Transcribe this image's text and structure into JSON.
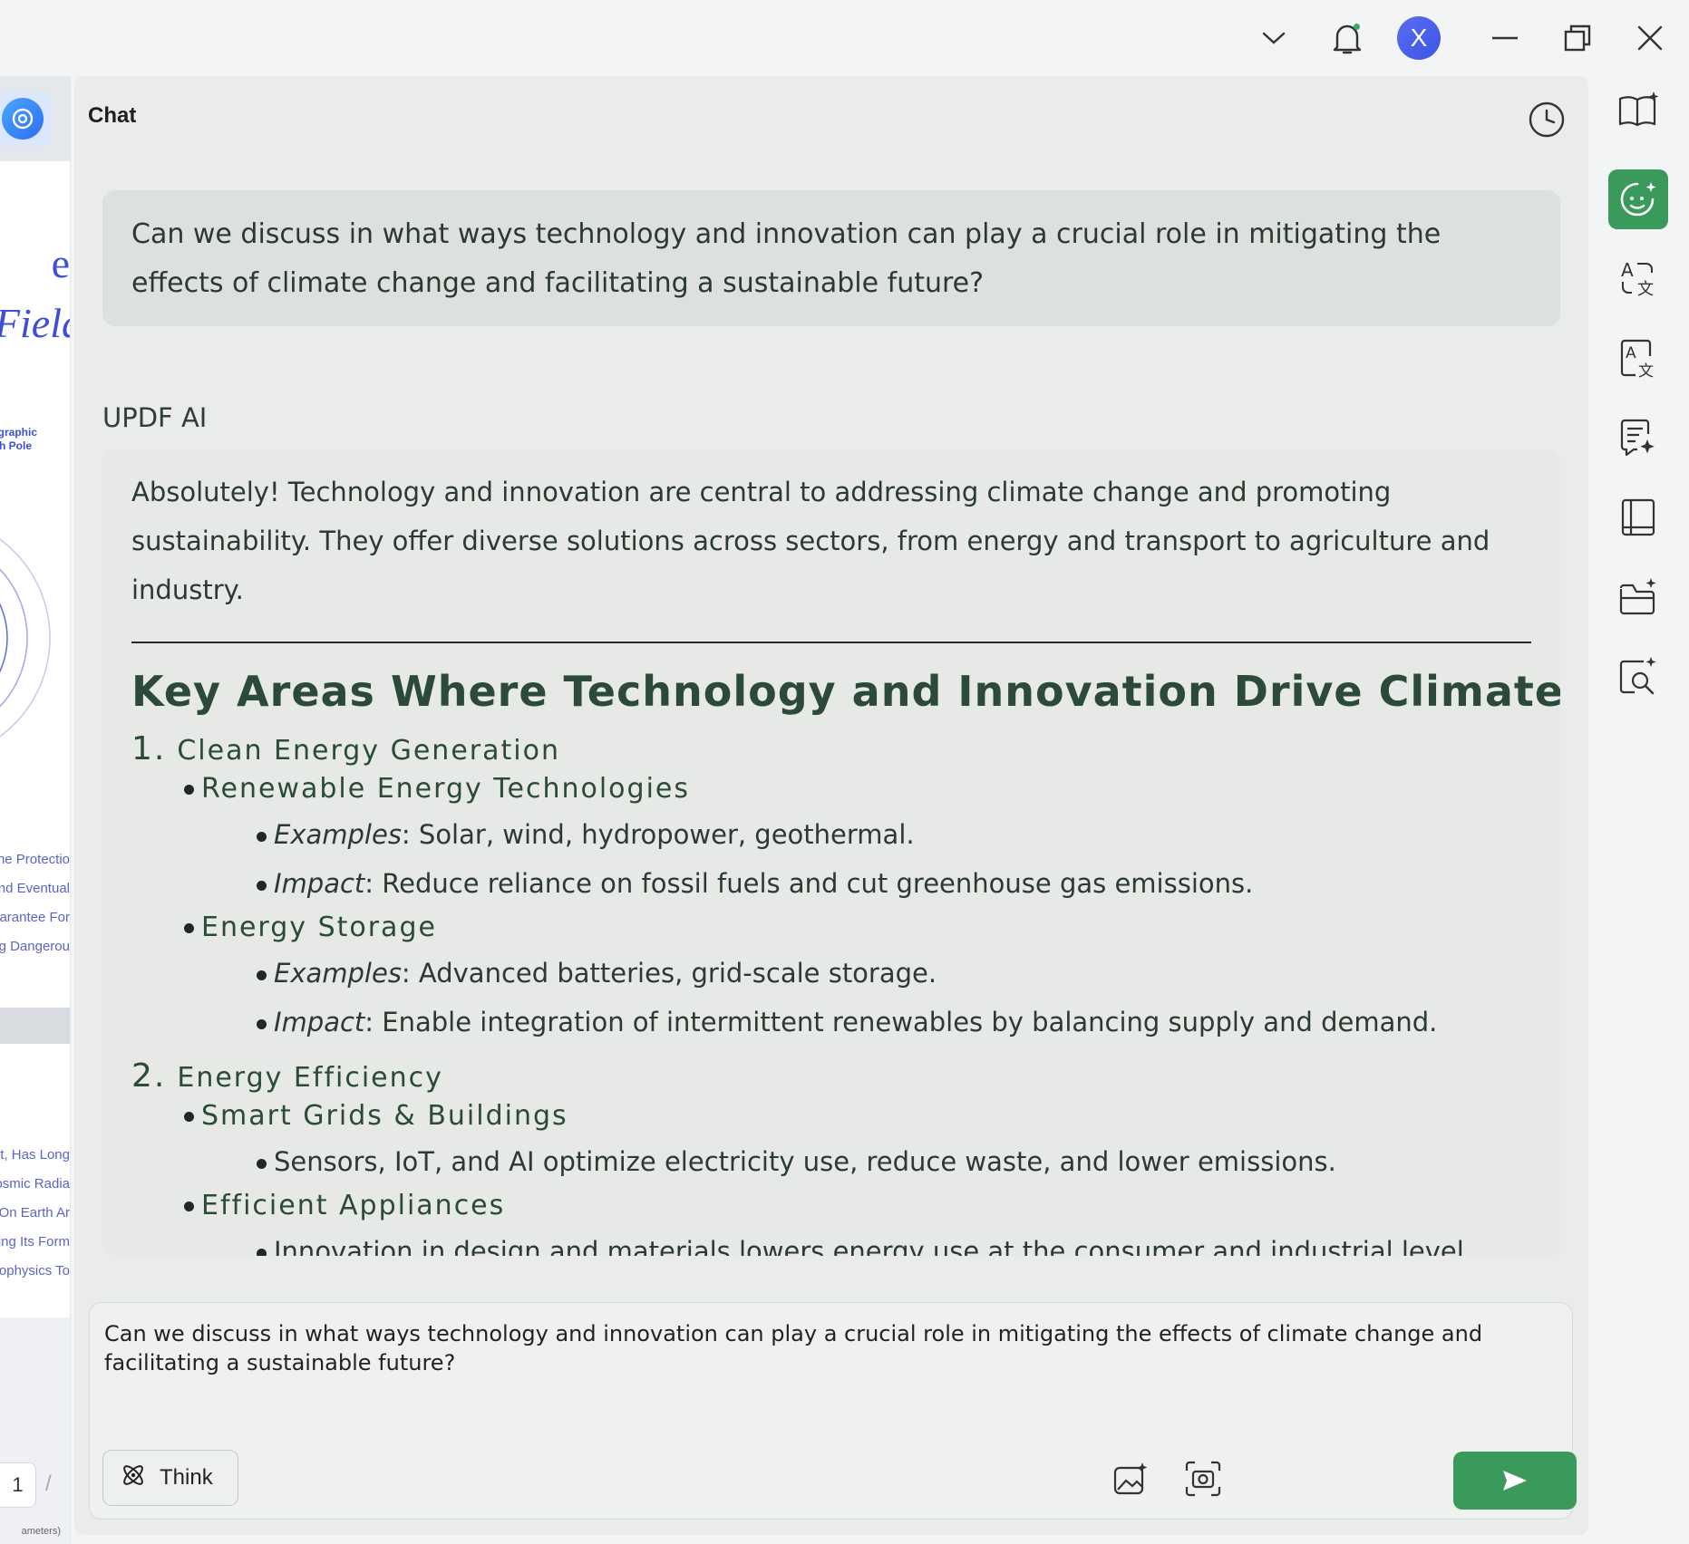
{
  "titlebar": {
    "avatar_letter": "X",
    "icons": [
      "chevron-down-icon",
      "bell-icon",
      "minimize-icon",
      "restore-icon",
      "close-icon"
    ]
  },
  "doc_preview": {
    "fragments_big": [
      "e",
      "Field"
    ],
    "fragments_tiny": [
      "graphic",
      "th Pole"
    ],
    "fragments_list_1": [
      "he Protectio",
      "nd Eventual",
      "arantee For",
      "g Dangerou"
    ],
    "fragments_list_2": [
      "et, Has Long",
      "osmic Radia",
      "On Earth Ar",
      "ing Its Form",
      "ophysics To"
    ],
    "page_number": "1",
    "page_sep": "/",
    "footer_fragment": "ameters)"
  },
  "chat": {
    "title": "Chat",
    "user_message": "Can we discuss in what ways technology and innovation can play a crucial role in mitigating the effects of climate change and facilitating a sustainable future?",
    "ai_label": "UPDF AI",
    "ai_intro": "Absolutely! Technology and innovation are central to addressing climate change and promoting sustainability. They offer diverse solutions across sectors, from energy and transport to agriculture and industry.",
    "heading": "Key Areas Where Technology and Innovation Drive Climate Action",
    "sections": [
      {
        "num": "1.",
        "title": "Clean Energy Generation",
        "subs": [
          {
            "title": "Renewable Energy Technologies",
            "items": [
              {
                "label": "Examples",
                "text": ": Solar, wind, hydropower, geothermal."
              },
              {
                "label": "Impact",
                "text": ": Reduce reliance on fossil fuels and cut greenhouse gas emissions."
              }
            ]
          },
          {
            "title": "Energy Storage",
            "items": [
              {
                "label": "Examples",
                "text": ": Advanced batteries, grid-scale storage."
              },
              {
                "label": "Impact",
                "text": ": Enable integration of intermittent renewables by balancing supply and demand."
              }
            ]
          }
        ]
      },
      {
        "num": "2.",
        "title": "Energy Efficiency",
        "subs": [
          {
            "title": "Smart Grids & Buildings",
            "items": [
              {
                "label": "",
                "text": "Sensors, IoT, and AI optimize electricity use, reduce waste, and lower emissions."
              }
            ]
          },
          {
            "title": "Efficient Appliances",
            "items": [
              {
                "label": "",
                "text": "Innovation in design and materials lowers energy use at the consumer and industrial level."
              }
            ]
          }
        ]
      }
    ],
    "input_value": "Can we discuss in what ways technology and innovation can play a crucial role in mitigating the effects of climate change and facilitating a sustainable future?",
    "think_label": "Think"
  },
  "right_toolbar": {
    "icons": [
      "book-sparkle-icon",
      "chat-bot-icon",
      "translate-icon",
      "translate-doc-icon",
      "summarize-icon",
      "notebook-icon",
      "folder-sparkle-icon",
      "search-sparkle-icon"
    ],
    "active": "chat-bot-icon"
  },
  "colors": {
    "accent": "#3a9a5b",
    "panel_bg": "#e9ecea",
    "avatar": "#4a5ff0"
  }
}
